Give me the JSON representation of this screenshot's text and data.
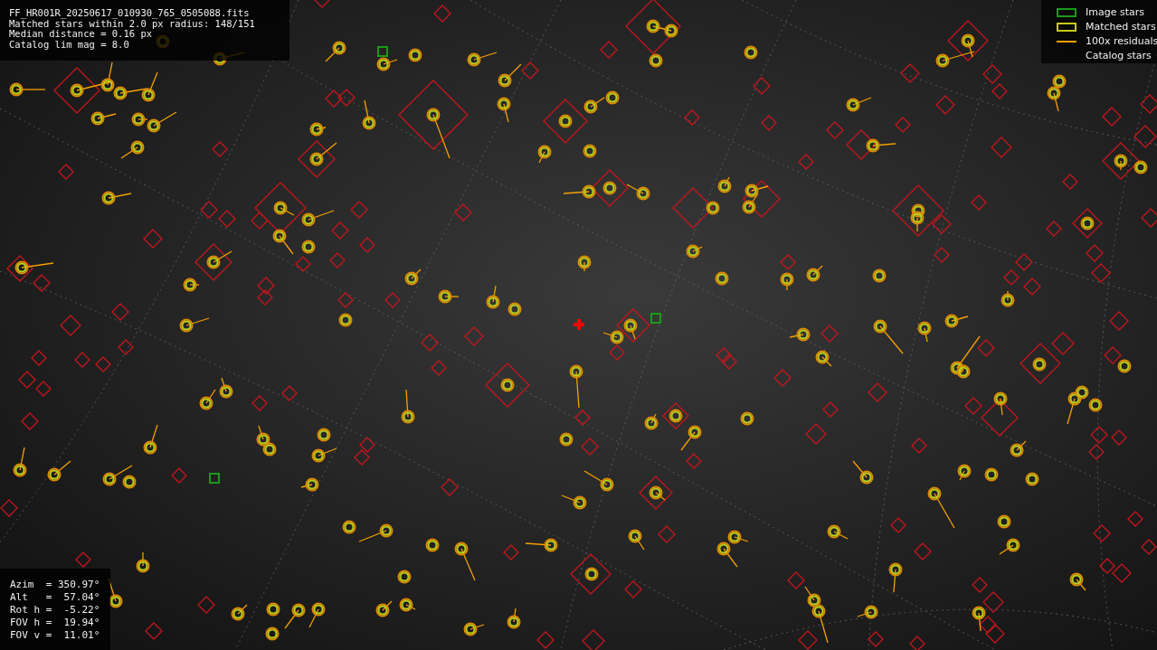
{
  "header": {
    "lines": [
      "FF_HR001R_20250617_010930_765_0505088.fits",
      "Matched stars within 2.0 px radius: 148/151",
      "Median distance = 0.16 px",
      "Catalog lim mag = 8.0"
    ]
  },
  "legend": [
    {
      "kind": "image",
      "label": "Image stars"
    },
    {
      "kind": "matched",
      "label": "Matched stars"
    },
    {
      "kind": "residual",
      "label": "100x residuals"
    },
    {
      "kind": "catalog",
      "label": "Catalog stars"
    }
  ],
  "pointing": {
    "lines": [
      "Azim  = 350.97°",
      "Alt   =  57.04°",
      "Rot h =  -5.22°",
      "FOV h =  19.94°",
      "FOV v =  11.01°"
    ]
  }
}
